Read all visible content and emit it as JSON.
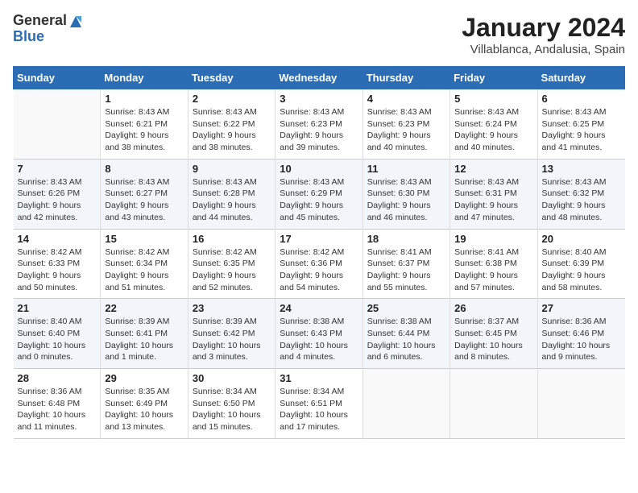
{
  "header": {
    "logo_general": "General",
    "logo_blue": "Blue",
    "month_year": "January 2024",
    "location": "Villablanca, Andalusia, Spain"
  },
  "calendar": {
    "days_of_week": [
      "Sunday",
      "Monday",
      "Tuesday",
      "Wednesday",
      "Thursday",
      "Friday",
      "Saturday"
    ],
    "weeks": [
      [
        {
          "day": "",
          "info": ""
        },
        {
          "day": "1",
          "info": "Sunrise: 8:43 AM\nSunset: 6:21 PM\nDaylight: 9 hours\nand 38 minutes."
        },
        {
          "day": "2",
          "info": "Sunrise: 8:43 AM\nSunset: 6:22 PM\nDaylight: 9 hours\nand 38 minutes."
        },
        {
          "day": "3",
          "info": "Sunrise: 8:43 AM\nSunset: 6:23 PM\nDaylight: 9 hours\nand 39 minutes."
        },
        {
          "day": "4",
          "info": "Sunrise: 8:43 AM\nSunset: 6:23 PM\nDaylight: 9 hours\nand 40 minutes."
        },
        {
          "day": "5",
          "info": "Sunrise: 8:43 AM\nSunset: 6:24 PM\nDaylight: 9 hours\nand 40 minutes."
        },
        {
          "day": "6",
          "info": "Sunrise: 8:43 AM\nSunset: 6:25 PM\nDaylight: 9 hours\nand 41 minutes."
        }
      ],
      [
        {
          "day": "7",
          "info": "Sunrise: 8:43 AM\nSunset: 6:26 PM\nDaylight: 9 hours\nand 42 minutes."
        },
        {
          "day": "8",
          "info": "Sunrise: 8:43 AM\nSunset: 6:27 PM\nDaylight: 9 hours\nand 43 minutes."
        },
        {
          "day": "9",
          "info": "Sunrise: 8:43 AM\nSunset: 6:28 PM\nDaylight: 9 hours\nand 44 minutes."
        },
        {
          "day": "10",
          "info": "Sunrise: 8:43 AM\nSunset: 6:29 PM\nDaylight: 9 hours\nand 45 minutes."
        },
        {
          "day": "11",
          "info": "Sunrise: 8:43 AM\nSunset: 6:30 PM\nDaylight: 9 hours\nand 46 minutes."
        },
        {
          "day": "12",
          "info": "Sunrise: 8:43 AM\nSunset: 6:31 PM\nDaylight: 9 hours\nand 47 minutes."
        },
        {
          "day": "13",
          "info": "Sunrise: 8:43 AM\nSunset: 6:32 PM\nDaylight: 9 hours\nand 48 minutes."
        }
      ],
      [
        {
          "day": "14",
          "info": "Sunrise: 8:42 AM\nSunset: 6:33 PM\nDaylight: 9 hours\nand 50 minutes."
        },
        {
          "day": "15",
          "info": "Sunrise: 8:42 AM\nSunset: 6:34 PM\nDaylight: 9 hours\nand 51 minutes."
        },
        {
          "day": "16",
          "info": "Sunrise: 8:42 AM\nSunset: 6:35 PM\nDaylight: 9 hours\nand 52 minutes."
        },
        {
          "day": "17",
          "info": "Sunrise: 8:42 AM\nSunset: 6:36 PM\nDaylight: 9 hours\nand 54 minutes."
        },
        {
          "day": "18",
          "info": "Sunrise: 8:41 AM\nSunset: 6:37 PM\nDaylight: 9 hours\nand 55 minutes."
        },
        {
          "day": "19",
          "info": "Sunrise: 8:41 AM\nSunset: 6:38 PM\nDaylight: 9 hours\nand 57 minutes."
        },
        {
          "day": "20",
          "info": "Sunrise: 8:40 AM\nSunset: 6:39 PM\nDaylight: 9 hours\nand 58 minutes."
        }
      ],
      [
        {
          "day": "21",
          "info": "Sunrise: 8:40 AM\nSunset: 6:40 PM\nDaylight: 10 hours\nand 0 minutes."
        },
        {
          "day": "22",
          "info": "Sunrise: 8:39 AM\nSunset: 6:41 PM\nDaylight: 10 hours\nand 1 minute."
        },
        {
          "day": "23",
          "info": "Sunrise: 8:39 AM\nSunset: 6:42 PM\nDaylight: 10 hours\nand 3 minutes."
        },
        {
          "day": "24",
          "info": "Sunrise: 8:38 AM\nSunset: 6:43 PM\nDaylight: 10 hours\nand 4 minutes."
        },
        {
          "day": "25",
          "info": "Sunrise: 8:38 AM\nSunset: 6:44 PM\nDaylight: 10 hours\nand 6 minutes."
        },
        {
          "day": "26",
          "info": "Sunrise: 8:37 AM\nSunset: 6:45 PM\nDaylight: 10 hours\nand 8 minutes."
        },
        {
          "day": "27",
          "info": "Sunrise: 8:36 AM\nSunset: 6:46 PM\nDaylight: 10 hours\nand 9 minutes."
        }
      ],
      [
        {
          "day": "28",
          "info": "Sunrise: 8:36 AM\nSunset: 6:48 PM\nDaylight: 10 hours\nand 11 minutes."
        },
        {
          "day": "29",
          "info": "Sunrise: 8:35 AM\nSunset: 6:49 PM\nDaylight: 10 hours\nand 13 minutes."
        },
        {
          "day": "30",
          "info": "Sunrise: 8:34 AM\nSunset: 6:50 PM\nDaylight: 10 hours\nand 15 minutes."
        },
        {
          "day": "31",
          "info": "Sunrise: 8:34 AM\nSunset: 6:51 PM\nDaylight: 10 hours\nand 17 minutes."
        },
        {
          "day": "",
          "info": ""
        },
        {
          "day": "",
          "info": ""
        },
        {
          "day": "",
          "info": ""
        }
      ]
    ]
  }
}
